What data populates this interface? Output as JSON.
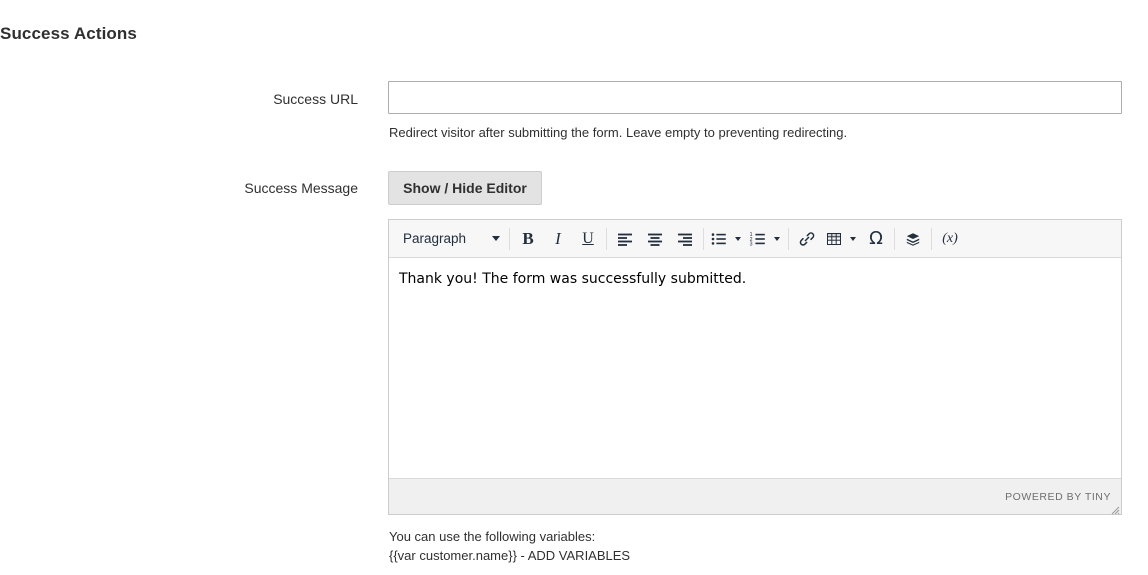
{
  "section": {
    "title": "Success Actions"
  },
  "fields": {
    "success_url": {
      "label": "Success URL",
      "value": "",
      "placeholder": "",
      "note": "Redirect visitor after submitting the form. Leave empty to preventing redirecting."
    },
    "success_message": {
      "label": "Success Message",
      "toggle_button": "Show / Hide Editor"
    }
  },
  "editor": {
    "format_select": {
      "value": "Paragraph",
      "caret_icon": "chevron-down-icon"
    },
    "toolbar": [
      {
        "name": "bold",
        "label": "B",
        "icon": "bold-icon"
      },
      {
        "name": "italic",
        "label": "I",
        "icon": "italic-icon"
      },
      {
        "name": "underline",
        "label": "U",
        "icon": "underline-icon"
      },
      {
        "name": "align-left",
        "icon": "align-left-icon"
      },
      {
        "name": "align-center",
        "icon": "align-center-icon"
      },
      {
        "name": "align-right",
        "icon": "align-right-icon"
      },
      {
        "name": "bullet-list",
        "icon": "bullet-list-icon"
      },
      {
        "name": "numbered-list",
        "icon": "numbered-list-icon"
      },
      {
        "name": "link",
        "icon": "link-icon"
      },
      {
        "name": "table",
        "icon": "table-icon"
      },
      {
        "name": "special-character",
        "label": "Ω",
        "icon": "omega-icon"
      },
      {
        "name": "insert-widget",
        "icon": "widget-stack-icon"
      },
      {
        "name": "insert-variable",
        "label": "(x)",
        "icon": "variable-icon"
      }
    ],
    "content": "Thank you! The form was successfully submitted.",
    "statusbar": {
      "brand": "POWERED BY TINY",
      "resize_handle": "resize-grip-icon"
    }
  },
  "variables_note": {
    "line1": "You can use the following variables:",
    "line2": "{{var customer.name}} - ADD VARIABLES"
  },
  "colors": {
    "text": "#303030",
    "border": "#cccccc",
    "input_border": "#adadad",
    "button_bg": "#e3e3e3",
    "toolbar_bg": "#f7f7f7",
    "statusbar_bg": "#f0f0f0",
    "brand_text": "#706f6f"
  }
}
